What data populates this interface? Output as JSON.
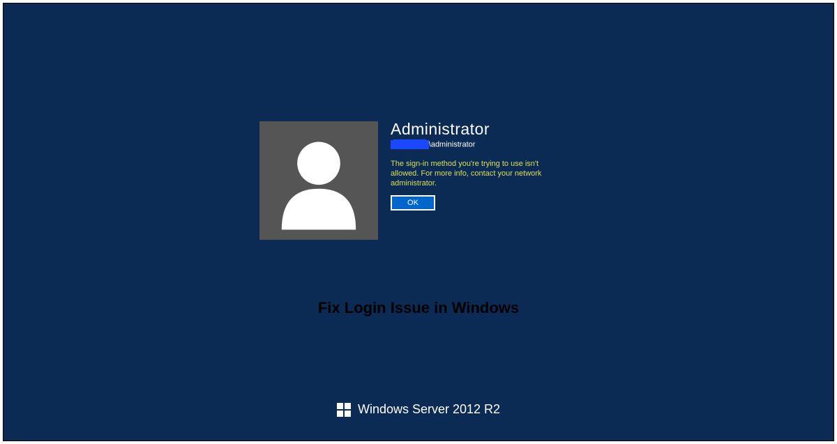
{
  "login": {
    "username": "Administrator",
    "domain_redacted": "██████",
    "domain_suffix": "\\administrator",
    "error_message": "The sign-in method you're trying to use isn't allowed. For more info, contact your network administrator.",
    "ok_label": "OK"
  },
  "overlay": {
    "caption": "Fix Login Issue in Windows"
  },
  "footer": {
    "brand_text": "Windows Server 2012 R2"
  },
  "colors": {
    "background": "#0b2a54",
    "avatar_bg": "#555555",
    "error_text": "#d8e05a",
    "button_bg": "#0066cc",
    "redaction": "#1b48ff"
  }
}
